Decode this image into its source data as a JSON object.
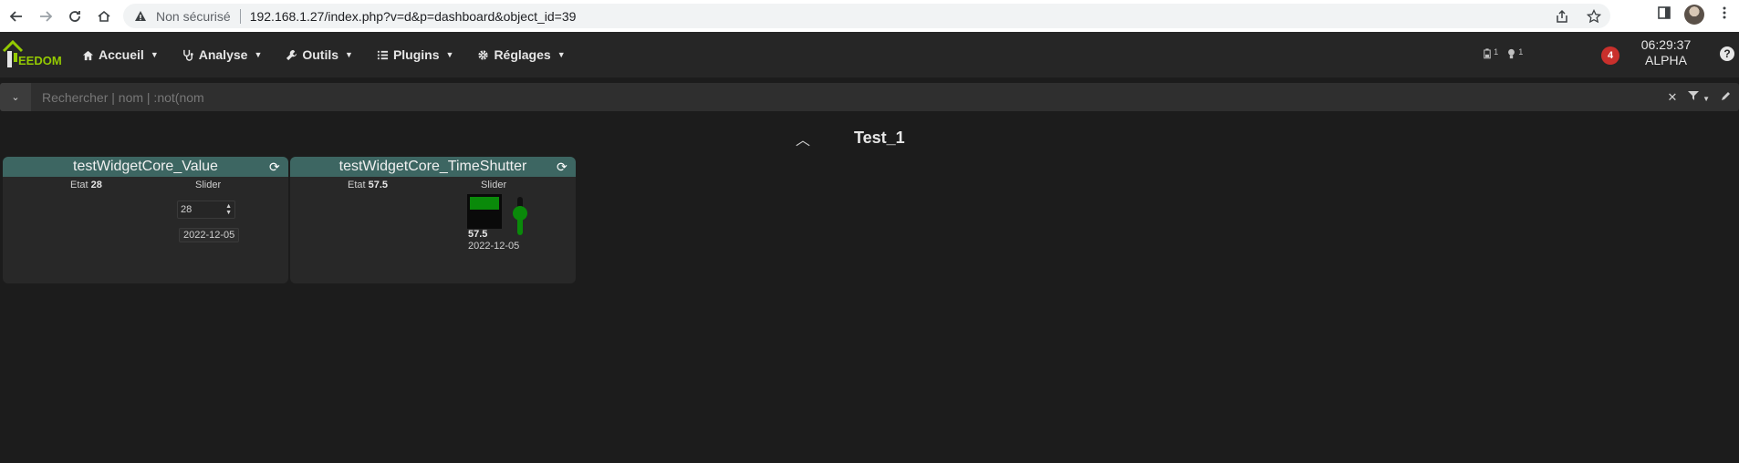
{
  "browser": {
    "security_label": "Non sécurisé",
    "url": "192.168.1.27/index.php?v=d&p=dashboard&object_id=39"
  },
  "app": {
    "logo_text": "EEDOM",
    "menu": [
      {
        "label": "Accueil",
        "icon": "home-icon"
      },
      {
        "label": "Analyse",
        "icon": "stethoscope-icon"
      },
      {
        "label": "Outils",
        "icon": "wrench-icon"
      },
      {
        "label": "Plugins",
        "icon": "list-icon"
      },
      {
        "label": "Réglages",
        "icon": "gear-icon"
      }
    ],
    "status_counts": {
      "battery": "1",
      "bulb": "1"
    },
    "notification_count": "4",
    "time": "06:29:37",
    "user": "ALPHA"
  },
  "search": {
    "placeholder": "Rechercher | nom | :not(nom"
  },
  "object": {
    "title": "Test_1"
  },
  "widgets": [
    {
      "name": "testWidgetCore_Value",
      "etat_label": "Etat",
      "etat_value": "28",
      "slider_label": "Slider",
      "slider_value": "28",
      "date": "2022-12-05"
    },
    {
      "name": "testWidgetCore_TimeShutter",
      "etat_label": "Etat",
      "etat_value": "57.5",
      "slider_label": "Slider",
      "shutter_value": "57.5",
      "shutter_level": 0.575,
      "date": "2022-12-05"
    }
  ],
  "colors": {
    "accent_green": "#94ca02",
    "widget_header": "#3d6662",
    "level_green": "#0a8a0a",
    "badge_red": "#c9302c"
  }
}
